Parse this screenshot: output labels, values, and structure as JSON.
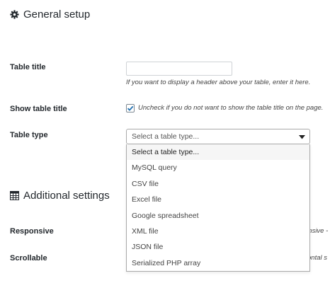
{
  "general": {
    "title": "General setup",
    "icon": "gear-icon"
  },
  "fields": {
    "table_title": {
      "label": "Table title",
      "value": "",
      "hint": "If you want to display a header above your table, enter it here."
    },
    "show_title": {
      "label": "Show table title",
      "checked": true,
      "hint": "Uncheck if you do not want to show the table title on the page."
    },
    "table_type": {
      "label": "Table type",
      "placeholder": "Select a table type...",
      "options": [
        "Select a table type...",
        "MySQL query",
        "CSV file",
        "Excel file",
        "Google spreadsheet",
        "XML file",
        "JSON file",
        "Serialized PHP array"
      ]
    }
  },
  "additional": {
    "title": "Additional settings",
    "icon": "grid-icon",
    "responsive": {
      "label": "Responsive",
      "hint_fragment": "onsive -"
    },
    "scrollable": {
      "label": "Scrollable",
      "hint_fragment": "ontal s"
    }
  },
  "colors": {
    "accent": "#2271b1"
  }
}
